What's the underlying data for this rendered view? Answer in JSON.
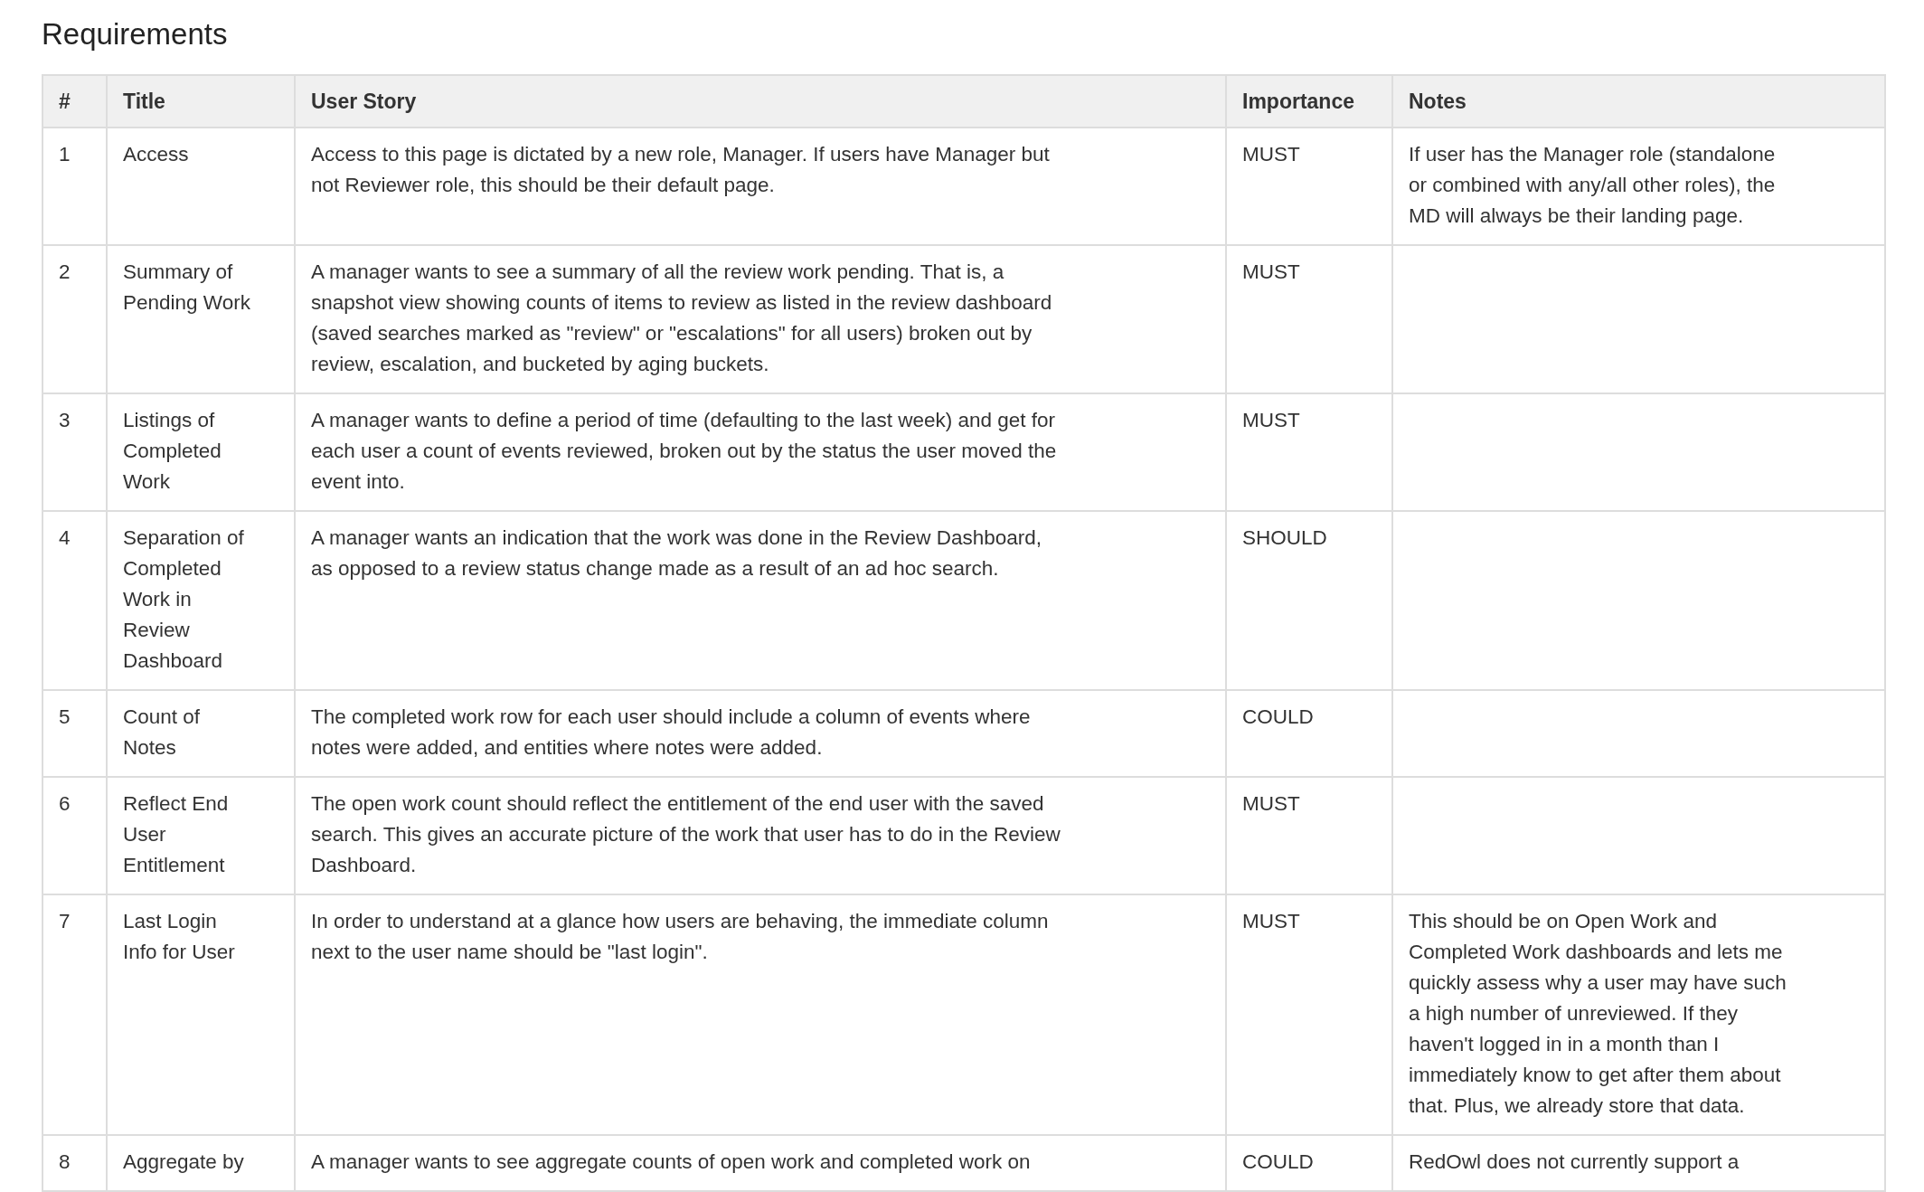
{
  "heading": "Requirements",
  "table": {
    "columns": [
      "#",
      "Title",
      "User Story",
      "Importance",
      "Notes"
    ],
    "rows": [
      {
        "number": "1",
        "title": [
          "Access"
        ],
        "story": [
          "Access to this page is dictated by a new role, Manager. If users have Manager but",
          "not Reviewer role, this should be their default page."
        ],
        "importance": "MUST",
        "notes": [
          "If user has the Manager role (standalone",
          "or combined with any/all other roles), the",
          "MD will always be their landing page."
        ]
      },
      {
        "number": "2",
        "title": [
          "Summary of",
          "Pending Work"
        ],
        "story": [
          "A manager wants to see a summary of all the review work pending. That is, a",
          "snapshot view showing counts of items to review as listed in the review dashboard",
          "(saved searches marked as \"review\" or \"escalations\" for all users) broken out by",
          "review, escalation, and bucketed by aging buckets."
        ],
        "importance": "MUST",
        "notes": []
      },
      {
        "number": "3",
        "title": [
          "Listings of",
          "Completed",
          "Work"
        ],
        "story": [
          "A manager wants to define a period of time (defaulting to the last week) and get for",
          "each user a count of events reviewed, broken out by the status the user moved the",
          "event into."
        ],
        "importance": "MUST",
        "notes": []
      },
      {
        "number": "4",
        "title": [
          "Separation of",
          "Completed",
          "Work in",
          "Review",
          "Dashboard"
        ],
        "story": [
          "A manager wants an indication that the work was done in the Review Dashboard,",
          "as opposed to a review status change made as a result of an ad hoc search."
        ],
        "importance": "SHOULD",
        "notes": []
      },
      {
        "number": "5",
        "title": [
          "Count of",
          "Notes"
        ],
        "story": [
          "The completed work row for each user should include a column of events where",
          "notes were added, and entities where notes were added."
        ],
        "importance": "COULD",
        "notes": []
      },
      {
        "number": "6",
        "title": [
          "Reflect End",
          "User",
          "Entitlement"
        ],
        "story": [
          "The open work count should reflect the entitlement of the end user with the saved",
          "search. This gives an accurate picture of the work that user has to do in the Review",
          "Dashboard."
        ],
        "importance": "MUST",
        "notes": []
      },
      {
        "number": "7",
        "title": [
          "Last Login",
          "Info for User"
        ],
        "story": [
          "In order to understand at a glance how users are behaving, the immediate column",
          "next to the user name should be \"last login\"."
        ],
        "importance": "MUST",
        "notes": [
          "This should be on Open Work and",
          "Completed Work dashboards and lets me",
          "quickly assess why a user may have such",
          "a high number of unreviewed. If they",
          "haven't logged in in a month than I",
          "immediately know to get after them about",
          "that. Plus, we already store that data."
        ]
      },
      {
        "number": "8",
        "title": [
          "Aggregate by"
        ],
        "story": [
          "A manager wants to see aggregate counts of open work and completed work on"
        ],
        "importance": "COULD",
        "notes": [
          "RedOwl does not currently support a"
        ]
      }
    ]
  }
}
